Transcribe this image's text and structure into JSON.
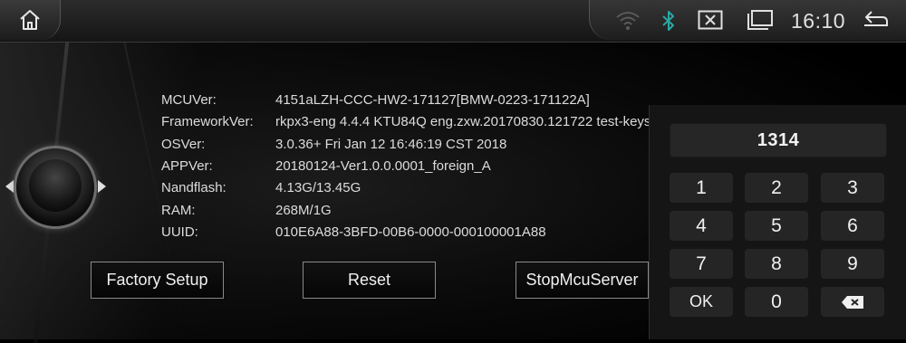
{
  "status_bar": {
    "time": "16:10",
    "icons": [
      "home-icon",
      "wifi-icon",
      "bluetooth-icon",
      "close-box-icon",
      "window-icon",
      "back-icon"
    ],
    "bluetooth_color": "#2aa8a4"
  },
  "system_info": [
    {
      "label": "MCUVer:",
      "value": "4151aLZH-CCC-HW2-171127[BMW-0223-171122A]"
    },
    {
      "label": "FrameworkVer:",
      "value": "rkpx3-eng 4.4.4 KTU84Q eng.zxw.20170830.121722 test-keys"
    },
    {
      "label": "OSVer:",
      "value": "3.0.36+  Fri Jan 12 16:46:19 CST 2018"
    },
    {
      "label": "APPVer:",
      "value": "20180124-Ver1.0.0.0001_foreign_A"
    },
    {
      "label": "Nandflash:",
      "value": "4.13G/13.45G"
    },
    {
      "label": "RAM:",
      "value": "268M/1G"
    },
    {
      "label": "UUID:",
      "value": "010E6A88-3BFD-00B6-0000-000100001A88"
    }
  ],
  "buttons": {
    "factory_setup": "Factory Setup",
    "reset": "Reset",
    "stop_mcu_server": "StopMcuServer"
  },
  "keypad": {
    "display_value": "1314",
    "keys": [
      "1",
      "2",
      "3",
      "4",
      "5",
      "6",
      "7",
      "8",
      "9",
      "OK",
      "0",
      "backspace-icon"
    ]
  }
}
